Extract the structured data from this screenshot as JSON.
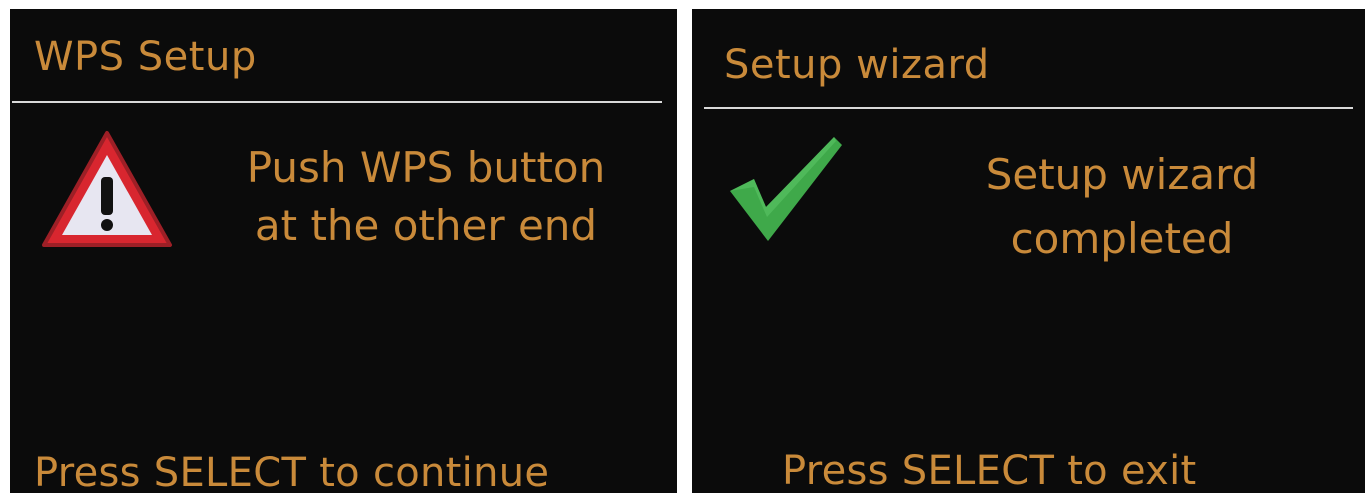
{
  "left_screen": {
    "title": "WPS Setup",
    "icon": "warning-triangle-icon",
    "message": {
      "line1": "Push WPS button",
      "line2": "at the other end"
    },
    "footer": "Press SELECT to continue",
    "colors": {
      "text": "#c98a3a",
      "background": "#0b0b0b",
      "warning_red": "#d8262f",
      "warning_fill": "#e7e6f1"
    }
  },
  "right_screen": {
    "title": "Setup wizard",
    "icon": "checkmark-icon",
    "message": {
      "line1": "Setup wizard",
      "line2": "completed"
    },
    "footer": "Press SELECT to exit",
    "colors": {
      "text": "#c98a3a",
      "background": "#0b0b0b",
      "check_green": "#3fa94a"
    }
  }
}
